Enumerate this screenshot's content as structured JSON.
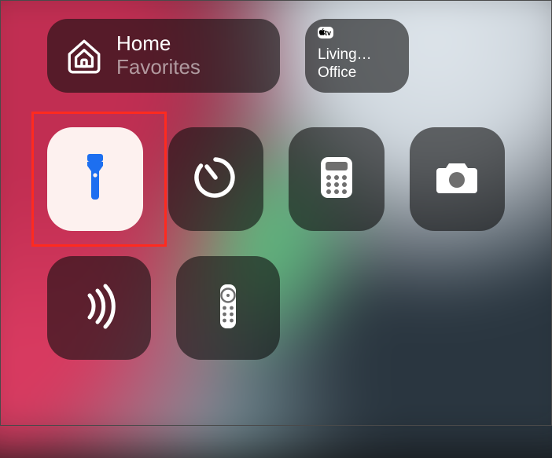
{
  "home_tile": {
    "title": "Home",
    "subtitle": "Favorites"
  },
  "appletv_tile": {
    "line1": "Living…",
    "line2": "Office"
  },
  "icons": {
    "flashlight": "flashlight-icon",
    "timer": "timer-icon",
    "calculator": "calculator-icon",
    "camera": "camera-icon",
    "nfc": "nfc-tag-reader-icon",
    "remote": "apple-tv-remote-icon",
    "home": "home-icon"
  },
  "ui": {
    "flashlight_active": true,
    "highlight_target": "flashlight-tile"
  },
  "colors": {
    "tile_bg": "rgba(15,15,15,0.60)",
    "active_bg": "#fdf1ef",
    "active_icon": "#1d6ff0",
    "highlight": "#ff2a1f"
  }
}
